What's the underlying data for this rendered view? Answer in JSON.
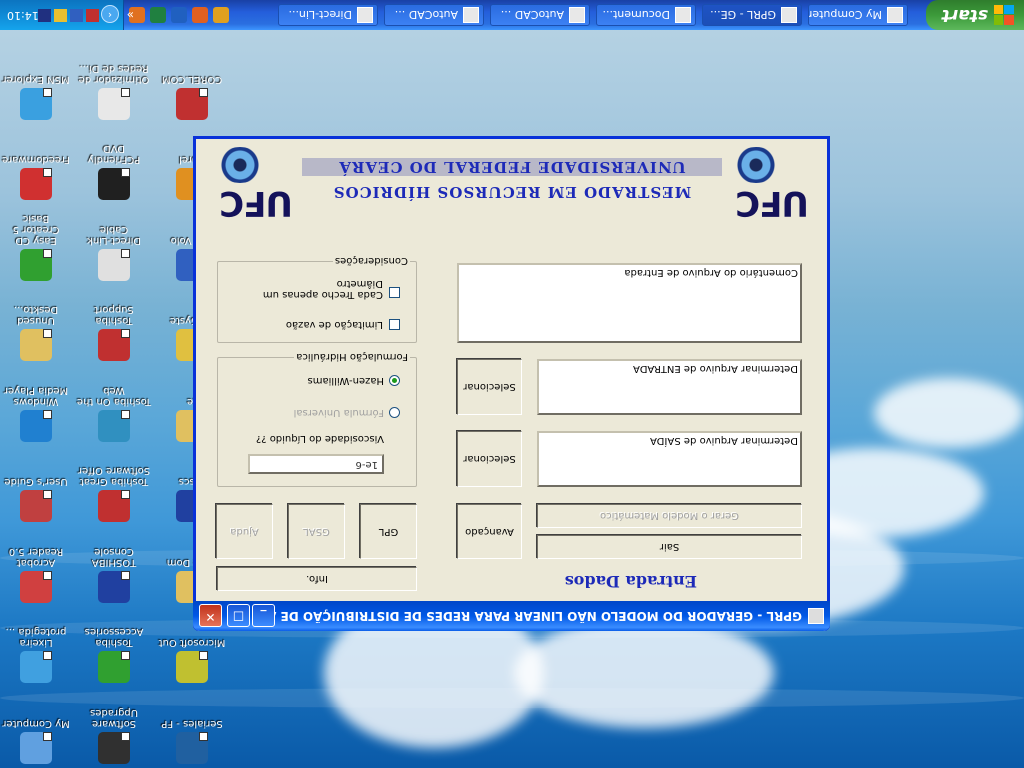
{
  "taskbar": {
    "start_label": "start",
    "tasks": [
      {
        "label": "Direct-Lin...",
        "active": false
      },
      {
        "label": "AutoCAD ...",
        "active": false
      },
      {
        "label": "AutoCAD ...",
        "active": false
      },
      {
        "label": "Document...",
        "active": false
      },
      {
        "label": "GPRL - GE...",
        "active": true
      },
      {
        "label": "My Computer",
        "active": false
      }
    ],
    "quick_launch_icons": [
      "ie-icon",
      "firefox-icon",
      "excel-icon",
      "outlook-icon",
      "grapher-icon",
      "folder-icon"
    ],
    "overflow_label": "»",
    "clock": "14:10"
  },
  "desktop_icons": [
    {
      "label": "MSN Explorer",
      "icon": "msn-butterfly-icon"
    },
    {
      "label": "Otimizador de Redes de Di...",
      "icon": "network-optimizer-icon"
    },
    {
      "label": "COREL.COM",
      "icon": "corel-icon"
    },
    {
      "label": "Freedomware",
      "icon": "freedomware-icon"
    },
    {
      "label": "PCFriendly DVD",
      "icon": "dvd-player-icon"
    },
    {
      "label": "Corel",
      "icon": "corel-draw-icon"
    },
    {
      "label": "Easy CD Creator 5 Basic",
      "icon": "easy-cd-icon"
    },
    {
      "label": "Direct-Link Cable",
      "icon": "direct-link-cable-icon"
    },
    {
      "label": "Exp Volo",
      "icon": "volo-icon"
    },
    {
      "label": "Unused Deskto...",
      "icon": "unused-desktop-folder-icon"
    },
    {
      "label": "Toshiba Support",
      "icon": "toshiba-support-icon"
    },
    {
      "label": "No Syste",
      "icon": "system-icon"
    },
    {
      "label": "Windows Media Player",
      "icon": "media-player-icon"
    },
    {
      "label": "Toshiba On the Web",
      "icon": "toshiba-web-icon"
    },
    {
      "label": "te",
      "icon": "folder-icon"
    },
    {
      "label": "User's Guide",
      "icon": "users-guide-icon"
    },
    {
      "label": "Toshiba Great Software Offer",
      "icon": "software-offer-icon"
    },
    {
      "label": "Discs",
      "icon": "disc-icon"
    },
    {
      "label": "Acrobat Reader 5.0",
      "icon": "acrobat-icon"
    },
    {
      "label": "TOSHIBA Console",
      "icon": "toshiba-console-icon"
    },
    {
      "label": "Acce Dom",
      "icon": "access-icon"
    },
    {
      "label": "Lixeira protegida ...",
      "icon": "recycle-bin-icon"
    },
    {
      "label": "Toshiba Accessories",
      "icon": "toshiba-accessories-icon"
    },
    {
      "label": "Microsoft Out",
      "icon": "outlook-express-icon"
    },
    {
      "label": "My Computer",
      "icon": "my-computer-icon"
    },
    {
      "label": "Software Upgrades",
      "icon": "software-upgrades-icon"
    },
    {
      "label": "Seriales - FP",
      "icon": "seriales-icon"
    }
  ],
  "window": {
    "title": "GPRL - GERADOR DO MODELO NÃO LINEAR PARA REDES DE DISTRIBUIÇÃO DE ÁGUA",
    "heading": "Entrada Dados",
    "buttons": {
      "info": "Info.",
      "sair": "Sair",
      "gerar": "Gerar o Modelo Matemático",
      "avancado": "Avançado",
      "gpl": "GPL",
      "gsal": "GSAL",
      "ajuda": "Ajuda",
      "selecionar_saida": "Selecionar",
      "selecionar_entrada": "Selecionar"
    },
    "fields": {
      "saida_label": "Determinar Arquivo de SAÍDA",
      "entrada_label": "Determinar Arquivo de ENTRADA",
      "comentario_label": "Comentário do Arquivo de Entrada"
    },
    "viscosity": {
      "value": "1e-6",
      "label": "Viscosidade do Líquido ??"
    },
    "formulacao": {
      "title": "Formulação Hidráulica",
      "options": [
        "Fórmula Universal",
        "Hazen-Williams"
      ],
      "selected": "Hazen-Williams"
    },
    "consideracoes": {
      "title": "Considerações",
      "options": [
        "Limitação de vazão",
        "Cada Trecho apenas um Diâmetro"
      ]
    },
    "footer": {
      "logo_text": "UFC",
      "line1": "MESTRADO EM RECURSOS HÍDRICOS",
      "line2": "UNIVERSIDADE FEDERAL DO CEARÁ"
    }
  }
}
